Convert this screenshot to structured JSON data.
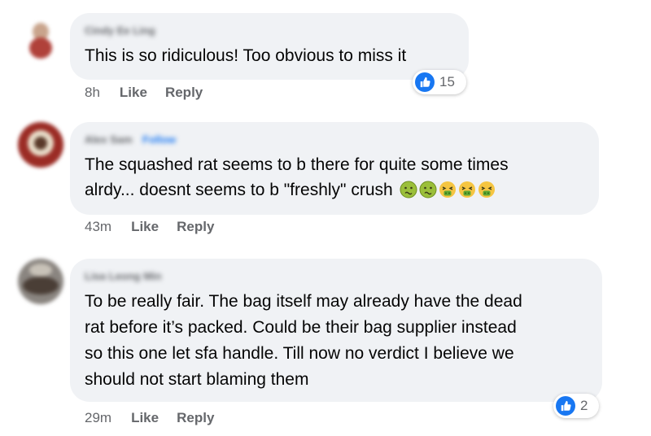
{
  "comments": [
    {
      "author": "Cindy Ee Ling",
      "text": "This is so ridiculous! Too obvious to miss it",
      "time": "8h",
      "like_label": "Like",
      "reply_label": "Reply",
      "reaction_count": "15"
    },
    {
      "author": "Alex Sam",
      "follow_label": "Follow",
      "text_line1": "The squashed rat seems to b there for quite some times",
      "text_line2": "alrdy... doesnt seems to b \"freshly\" crush",
      "emojis": [
        "nauseated-face",
        "nauseated-face",
        "vomiting-face",
        "vomiting-face",
        "vomiting-face"
      ],
      "time": "43m",
      "like_label": "Like",
      "reply_label": "Reply"
    },
    {
      "author": "Lisa Leong Min",
      "text_lines": [
        "To be really fair. The bag itself may already have the dead",
        "rat before it’s packed. Could be their bag supplier instead",
        "so this one let sfa handle. Till now no verdict I believe we",
        "should not start blaming them"
      ],
      "time": "29m",
      "like_label": "Like",
      "reply_label": "Reply",
      "reaction_count": "2"
    }
  ],
  "colors": {
    "bubble": "#f0f2f5",
    "like_blue": "#1877f2",
    "meta_gray": "#65676b"
  }
}
